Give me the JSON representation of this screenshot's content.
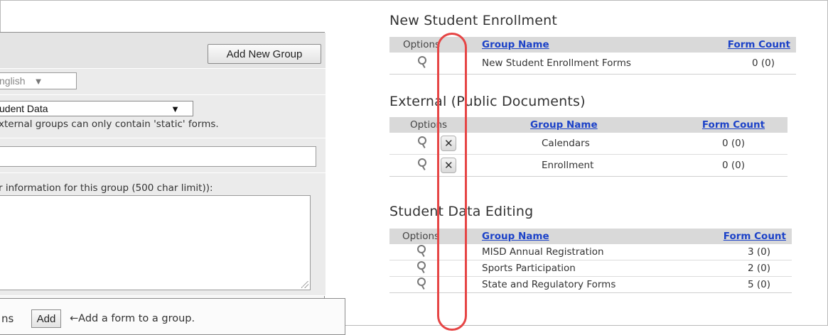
{
  "left": {
    "add_group_label": "Add New Group",
    "language_value": "nglish",
    "language_arrow": "▼",
    "type_value": "udent Data",
    "type_arrow": "▼",
    "type_note": "xternal groups can only contain 'static' forms.",
    "name_value": "",
    "info_label": "r information for this group (500 char limit)):",
    "info_value": "",
    "forms_label_partial": "ns",
    "add_label": "Add",
    "add_hint": "←Add a form to a group."
  },
  "sections": [
    {
      "title": "New Student Enrollment",
      "headers": {
        "options": "Options",
        "group_name": "Group Name",
        "form_count": "Form Count"
      },
      "rows": [
        {
          "name": "New Student Enrollment Forms",
          "count": "0 (0)"
        }
      ]
    },
    {
      "title": "External (Public Documents)",
      "headers": {
        "options": "Options",
        "group_name": "Group Name",
        "form_count": "Form Count"
      },
      "rows": [
        {
          "name": "Calendars",
          "count": "0 (0)"
        },
        {
          "name": "Enrollment",
          "count": "0 (0)"
        }
      ]
    },
    {
      "title": "Student Data Editing",
      "headers": {
        "options": "Options",
        "group_name": "Group Name",
        "form_count": "Form Count"
      },
      "rows": [
        {
          "name": "MISD Annual Registration",
          "count": "3 (0)"
        },
        {
          "name": "Sports Participation",
          "count": "2 (0)"
        },
        {
          "name": "State and Regulatory Forms",
          "count": "5 (0)"
        }
      ]
    }
  ],
  "icons": {
    "view": "magnifier-icon",
    "delete": "close-x-icon"
  },
  "colors": {
    "link": "#1c42c8",
    "header_bg": "#d9d9d9",
    "highlight": "#e64545"
  }
}
